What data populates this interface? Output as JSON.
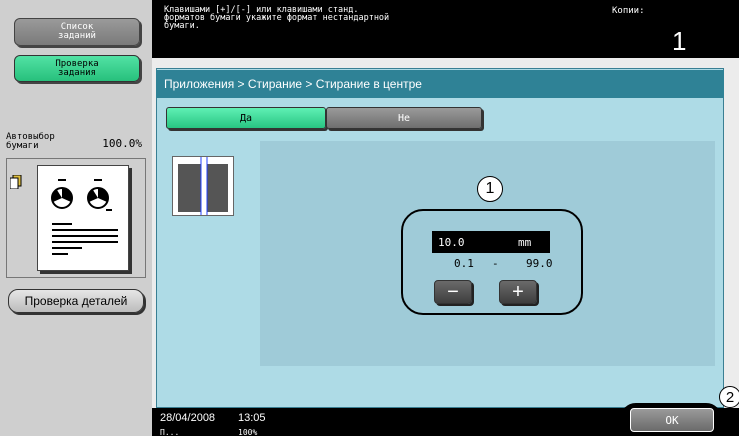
{
  "sidebar": {
    "job_list_label": "Список\nзаданий",
    "job_check_label": "Проверка\nзадания",
    "paper_auto_label": "Автовыбор\nбумаги",
    "paper_auto_value": "100.0%",
    "details_label": "Проверка деталей"
  },
  "message": {
    "text": "Клавишами [+]/[-] или клавишами станд.\nформатов бумаги укажите формат нестандартной\nбумаги.",
    "copies_label": "Копии:",
    "copies_value": "1"
  },
  "main": {
    "breadcrumb": "Приложения > Стирание > Стирание в центре",
    "tabs": {
      "yes": "Да",
      "no": "Не"
    },
    "callout_1": "1",
    "value": "10.0",
    "unit": "mm",
    "range_min": "0.1",
    "range_sep": "-",
    "range_max": "99.0"
  },
  "status": {
    "date": "28/04/2008",
    "time": "13:05",
    "sub_left": "П...",
    "sub_mid": "100%",
    "ok_label": "OK",
    "callout_2": "2"
  },
  "colors": {
    "accent_green": "#28c482",
    "header_teal": "#2f8296",
    "panel_bg": "#aedbe6"
  }
}
